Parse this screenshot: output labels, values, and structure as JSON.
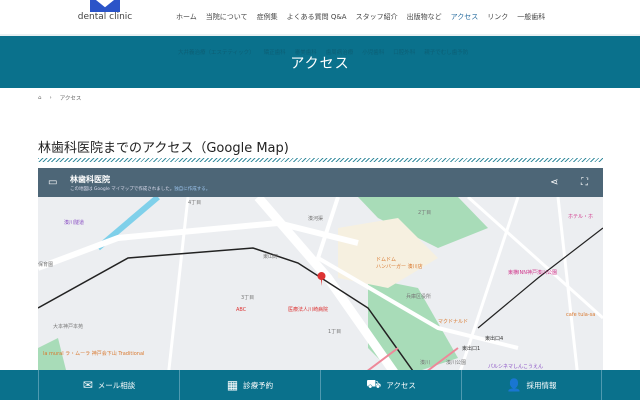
{
  "header": {
    "logo_text": "dental clinic",
    "nav": [
      "ホーム",
      "当院について",
      "症例集",
      "よくある質問 Q&A",
      "スタッフ紹介",
      "出版物など",
      "アクセス",
      "リンク",
      "一般歯科"
    ],
    "active": "アクセス"
  },
  "hero": {
    "submenu": [
      "大井義治療（エステティック）",
      "矯正歯科",
      "審美歯科",
      "歯周病治療",
      "小児歯科",
      "口腔外科",
      "親子でむし歯予防"
    ],
    "title": "アクセス"
  },
  "breadcrumb": {
    "home_icon": "home-icon",
    "current": "アクセス"
  },
  "section": {
    "title": "林歯科医院までのアクセス（Google Map)"
  },
  "map": {
    "title": "林歯科医院",
    "notice": "この地図は Google マイマップで作成されました。",
    "notice_link": "独自に作成する。",
    "labels": {
      "l1": "湊川隧道",
      "l2": "東山町",
      "l3": "ハンバーガー 湊川店",
      "l4": "兵庫区役所",
      "l5": "医療法人川崎病院",
      "l6": "ABC",
      "l7": "大本神戸本苑",
      "l8": "la mural ラ・ムーラ 神戸会下山 Traditional",
      "l9": "湊川",
      "l10": "湊川公園",
      "l11": "東横INN神戸湊川公園",
      "l12": "マクドナルド",
      "l13": "パルシネマしんこうえん",
      "l14": "湊河渠",
      "l15": "1丁目",
      "l16": "2丁目",
      "l17": "4丁目",
      "l18": "3丁目",
      "l19": "東出口1",
      "l20": "東出口4",
      "l21": "ホテル・ホ",
      "l22": "cafe tula-sa",
      "l23": "ドムドム",
      "l24": "保育園"
    }
  },
  "footer": [
    {
      "icon": "mail-icon",
      "label": "メール相談"
    },
    {
      "icon": "calendar-icon",
      "label": "診療予約"
    },
    {
      "icon": "car-icon",
      "label": "アクセス"
    },
    {
      "icon": "person-icon",
      "label": "採用情報"
    }
  ],
  "colors": {
    "primary": "#0a718c",
    "accent": "#2b54c8"
  }
}
